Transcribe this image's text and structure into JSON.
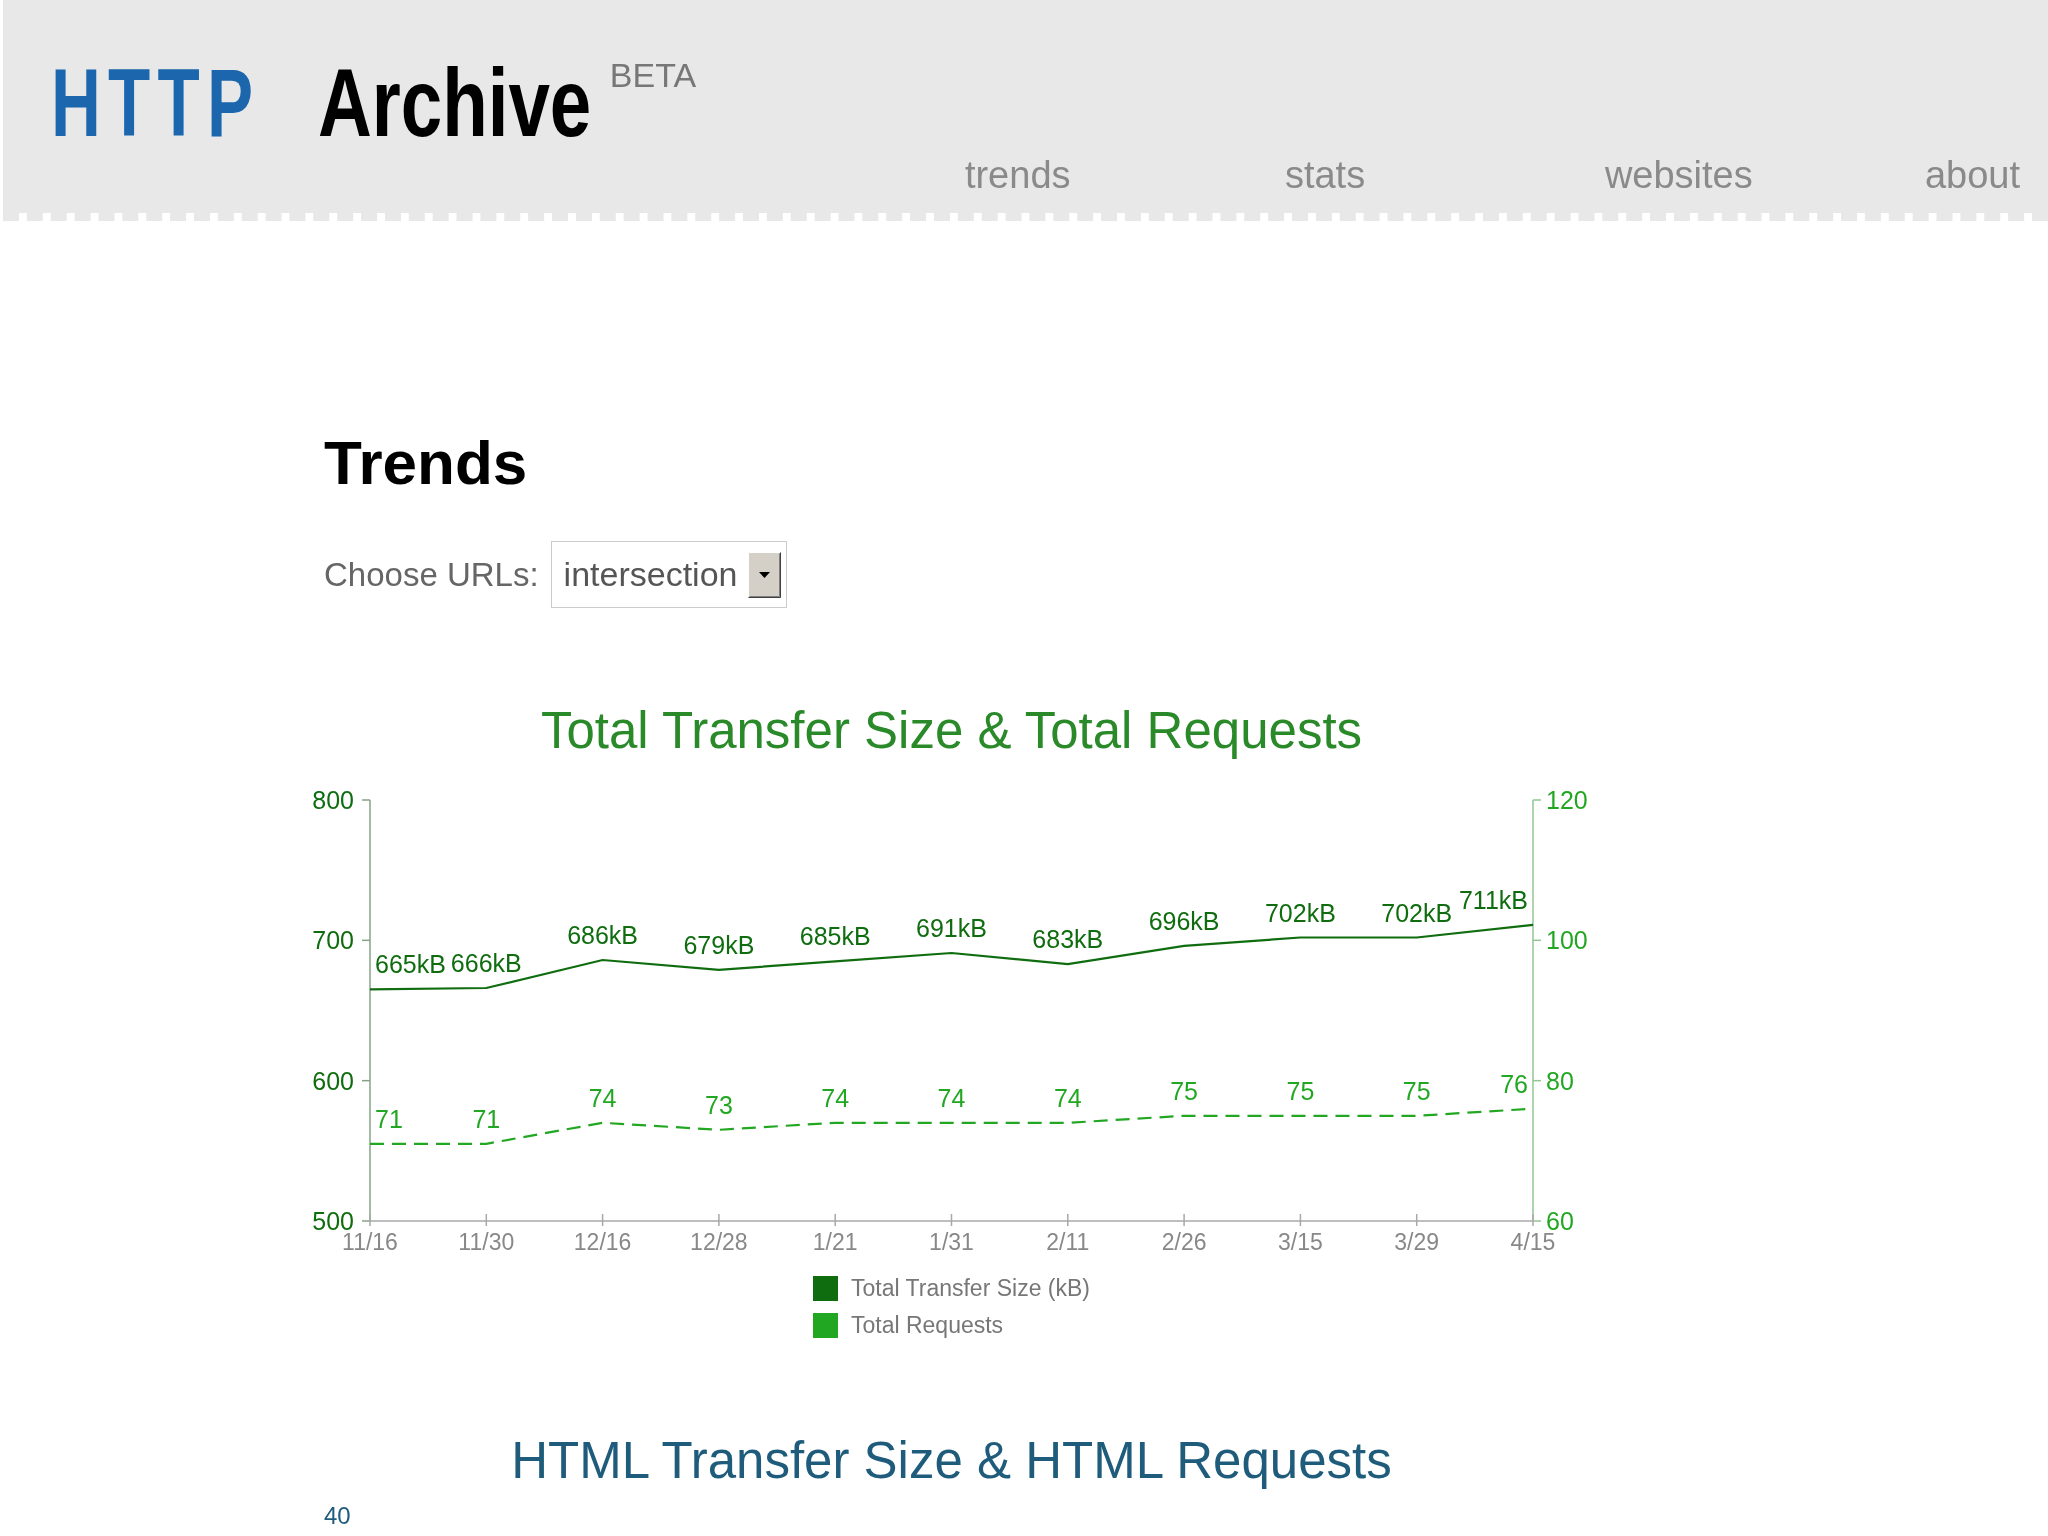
{
  "header": {
    "logo_primary": "HTTP",
    "logo_secondary": "Archive",
    "badge": "BETA",
    "nav": [
      "trends",
      "stats",
      "websites",
      "about"
    ]
  },
  "page": {
    "title": "Trends",
    "url_filter": {
      "label": "Choose URLs:",
      "value": "intersection"
    }
  },
  "charts": [
    {
      "color": "#2a8a2a",
      "chart_data": {
        "type": "line",
        "title": "Total Transfer Size & Total Requests",
        "categories": [
          "11/16",
          "11/30",
          "12/16",
          "12/28",
          "1/21",
          "1/31",
          "2/11",
          "2/26",
          "3/15",
          "3/29",
          "4/15"
        ],
        "series": [
          {
            "name": "Total Transfer Size (kB)",
            "color": "#0f6d0f",
            "values": [
              665,
              666,
              686,
              679,
              685,
              691,
              683,
              696,
              702,
              702,
              711
            ],
            "value_labels": [
              "665kB",
              "666kB",
              "686kB",
              "679kB",
              "685kB",
              "691kB",
              "683kB",
              "696kB",
              "702kB",
              "702kB",
              "711kB"
            ]
          },
          {
            "name": "Total Requests",
            "color": "#22a722",
            "axis": "y2",
            "line_style": "dashed",
            "values": [
              71,
              71,
              74,
              73,
              74,
              74,
              74,
              75,
              75,
              75,
              76
            ],
            "value_labels": [
              "71",
              "71",
              "74",
              "73",
              "74",
              "74",
              "74",
              "75",
              "75",
              "75",
              "76"
            ]
          }
        ],
        "ylim": [
          500,
          800
        ],
        "yticks": [
          500,
          600,
          700,
          800
        ],
        "y2lim": [
          60,
          120
        ],
        "y2ticks": [
          60,
          80,
          100,
          120
        ],
        "data_labels": true,
        "legend": "bottom"
      }
    },
    {
      "color": "#1f5c7c",
      "title": "HTML Transfer Size & HTML Requests",
      "axis_labels": [
        "40"
      ]
    }
  ]
}
